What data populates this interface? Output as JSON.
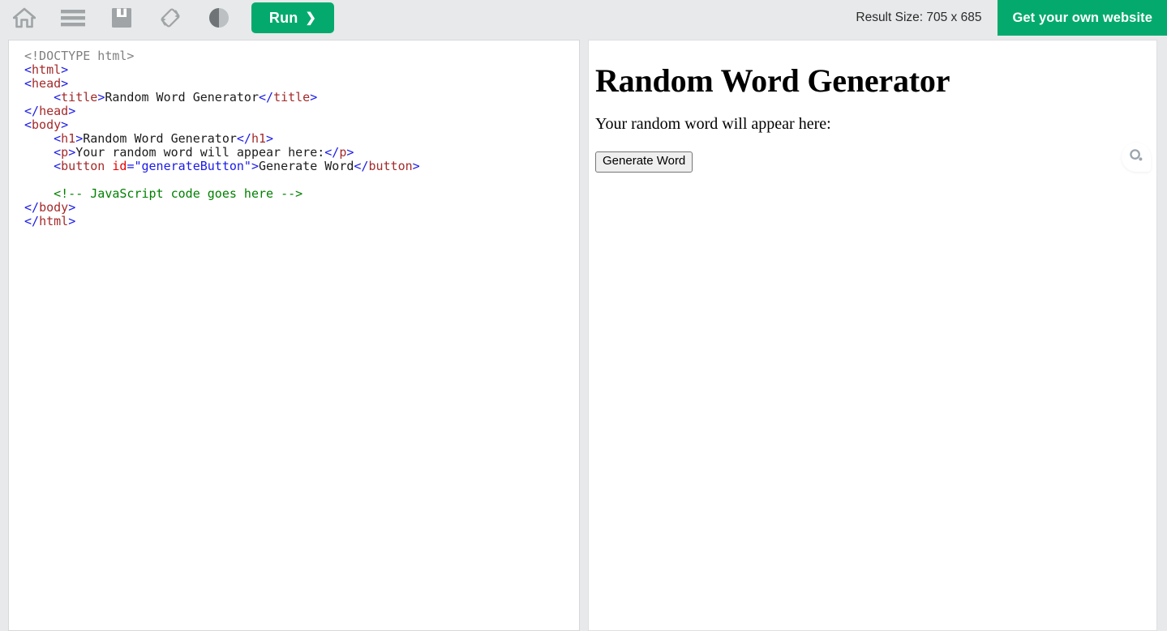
{
  "toolbar": {
    "icons": [
      {
        "name": "home-icon",
        "label": "Home"
      },
      {
        "name": "menu-icon",
        "label": "Menu"
      },
      {
        "name": "save-icon",
        "label": "Save"
      },
      {
        "name": "rotate-icon",
        "label": "Change Orientation"
      },
      {
        "name": "contrast-icon",
        "label": "Change Theme"
      }
    ],
    "run_label": "Run",
    "run_chevron": "❯",
    "run_color": "#04AA6D",
    "result_size_label": "Result Size: 705 x 685",
    "promo_label": "Get your own website",
    "promo_color": "#04AA6D",
    "background_color": "#e7e9ea"
  },
  "editor": {
    "language": "html",
    "syntax_colors": {
      "doctype": "#808080",
      "punctuation": "#1a1ae6",
      "tag": "#a52a2a",
      "attribute": "#e60000",
      "value": "#1a1ae6",
      "text": "#1c1c1c",
      "comment": "#008000"
    },
    "lines": [
      {
        "tokens": [
          {
            "t": "doctype",
            "v": "<!DOCTYPE html>"
          }
        ]
      },
      {
        "tokens": [
          {
            "t": "punct",
            "v": "<"
          },
          {
            "t": "tag",
            "v": "html"
          },
          {
            "t": "punct",
            "v": ">"
          }
        ]
      },
      {
        "tokens": [
          {
            "t": "punct",
            "v": "<"
          },
          {
            "t": "tag",
            "v": "head"
          },
          {
            "t": "punct",
            "v": ">"
          }
        ]
      },
      {
        "tokens": [
          {
            "t": "text",
            "v": "    "
          },
          {
            "t": "punct",
            "v": "<"
          },
          {
            "t": "tag",
            "v": "title"
          },
          {
            "t": "punct",
            "v": ">"
          },
          {
            "t": "text",
            "v": "Random Word Generator"
          },
          {
            "t": "punct",
            "v": "</"
          },
          {
            "t": "tag",
            "v": "title"
          },
          {
            "t": "punct",
            "v": ">"
          }
        ]
      },
      {
        "tokens": [
          {
            "t": "punct",
            "v": "</"
          },
          {
            "t": "tag",
            "v": "head"
          },
          {
            "t": "punct",
            "v": ">"
          }
        ]
      },
      {
        "tokens": [
          {
            "t": "punct",
            "v": "<"
          },
          {
            "t": "tag",
            "v": "body"
          },
          {
            "t": "punct",
            "v": ">"
          }
        ]
      },
      {
        "tokens": [
          {
            "t": "text",
            "v": "    "
          },
          {
            "t": "punct",
            "v": "<"
          },
          {
            "t": "tag",
            "v": "h1"
          },
          {
            "t": "punct",
            "v": ">"
          },
          {
            "t": "text",
            "v": "Random Word Generator"
          },
          {
            "t": "punct",
            "v": "</"
          },
          {
            "t": "tag",
            "v": "h1"
          },
          {
            "t": "punct",
            "v": ">"
          }
        ]
      },
      {
        "tokens": [
          {
            "t": "text",
            "v": "    "
          },
          {
            "t": "punct",
            "v": "<"
          },
          {
            "t": "tag",
            "v": "p"
          },
          {
            "t": "punct",
            "v": ">"
          },
          {
            "t": "text",
            "v": "Your random word will appear here:"
          },
          {
            "t": "punct",
            "v": "</"
          },
          {
            "t": "tag",
            "v": "p"
          },
          {
            "t": "punct",
            "v": ">"
          }
        ]
      },
      {
        "tokens": [
          {
            "t": "text",
            "v": "    "
          },
          {
            "t": "punct",
            "v": "<"
          },
          {
            "t": "tag",
            "v": "button"
          },
          {
            "t": "text",
            "v": " "
          },
          {
            "t": "attr",
            "v": "id"
          },
          {
            "t": "punct",
            "v": "="
          },
          {
            "t": "val",
            "v": "\"generateButton\""
          },
          {
            "t": "punct",
            "v": ">"
          },
          {
            "t": "text",
            "v": "Generate Word"
          },
          {
            "t": "punct",
            "v": "</"
          },
          {
            "t": "tag",
            "v": "button"
          },
          {
            "t": "punct",
            "v": ">"
          }
        ]
      },
      {
        "tokens": [
          {
            "t": "text",
            "v": ""
          }
        ]
      },
      {
        "tokens": [
          {
            "t": "text",
            "v": "    "
          },
          {
            "t": "comment",
            "v": "<!-- JavaScript code goes here -->"
          }
        ]
      },
      {
        "tokens": [
          {
            "t": "punct",
            "v": "</"
          },
          {
            "t": "tag",
            "v": "body"
          },
          {
            "t": "punct",
            "v": ">"
          }
        ]
      },
      {
        "tokens": [
          {
            "t": "punct",
            "v": "</"
          },
          {
            "t": "tag",
            "v": "html"
          },
          {
            "t": "punct",
            "v": ">"
          }
        ]
      }
    ]
  },
  "result": {
    "heading": "Random Word Generator",
    "paragraph": "Your random word will appear here:",
    "button_label": "Generate Word"
  },
  "feedback": {
    "icon": "feedback-icon"
  }
}
